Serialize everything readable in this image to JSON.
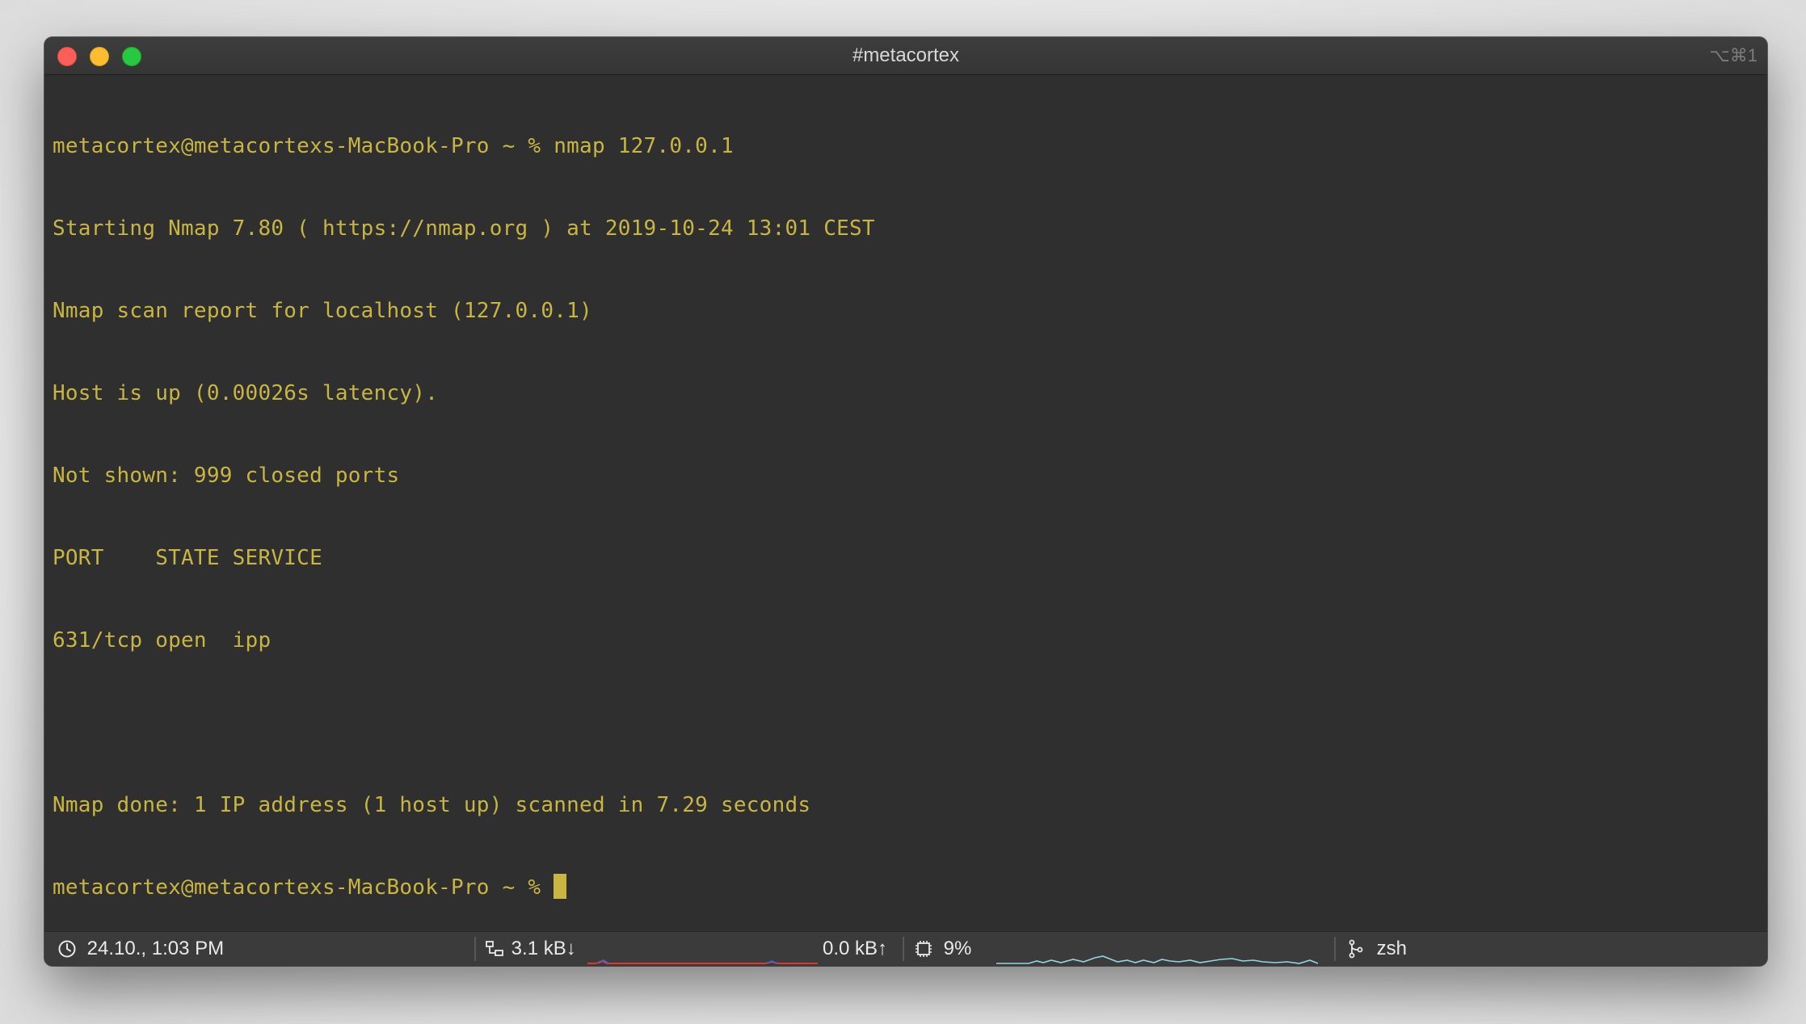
{
  "window": {
    "title": "#metacortex",
    "shortcut": "⌥⌘1"
  },
  "terminal": {
    "lines": [
      "metacortex@metacortexs-MacBook-Pro ~ % nmap 127.0.0.1",
      "Starting Nmap 7.80 ( https://nmap.org ) at 2019-10-24 13:01 CEST",
      "Nmap scan report for localhost (127.0.0.1)",
      "Host is up (0.00026s latency).",
      "Not shown: 999 closed ports",
      "PORT    STATE SERVICE",
      "631/tcp open  ipp",
      "",
      "Nmap done: 1 IP address (1 host up) scanned in 7.29 seconds"
    ],
    "prompt": "metacortex@metacortexs-MacBook-Pro ~ % ",
    "text_color": "#c8b542",
    "background": "#2f2f2f"
  },
  "statusbar": {
    "clock": "24.10., 1:03 PM",
    "net_down": "3.1 kB↓",
    "net_up": "0.0 kB↑",
    "cpu": "9%",
    "job": "zsh",
    "icons": [
      "clock-icon",
      "network-icon",
      "cpu-icon",
      "job-icon"
    ]
  }
}
